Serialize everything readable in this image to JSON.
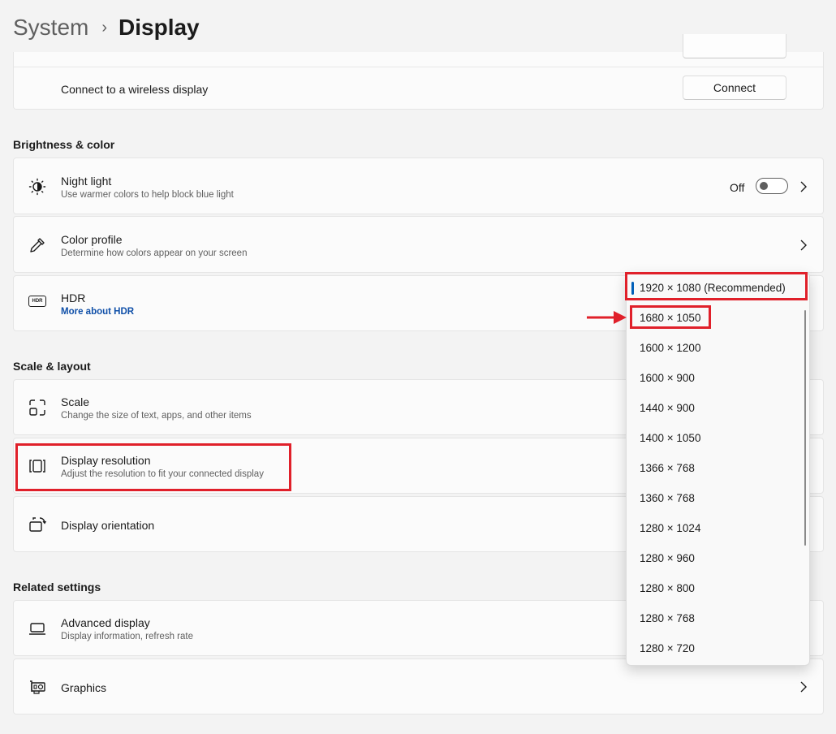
{
  "breadcrumb": {
    "parent": "System",
    "current": "Display"
  },
  "wireless": {
    "title": "Connect to a wireless display",
    "button": "Connect"
  },
  "sections": {
    "brightness": "Brightness & color",
    "scale_layout": "Scale & layout",
    "related": "Related settings"
  },
  "rows": {
    "night_light": {
      "title": "Night light",
      "subtitle": "Use warmer colors to help block blue light",
      "state": "Off"
    },
    "color_profile": {
      "title": "Color profile",
      "subtitle": "Determine how colors appear on your screen"
    },
    "hdr": {
      "title": "HDR",
      "link": "More about HDR",
      "icon_text": "HDR"
    },
    "scale": {
      "title": "Scale",
      "subtitle": "Change the size of text, apps, and other items"
    },
    "resolution": {
      "title": "Display resolution",
      "subtitle": "Adjust the resolution to fit your connected display"
    },
    "orientation": {
      "title": "Display orientation"
    },
    "advanced": {
      "title": "Advanced display",
      "subtitle": "Display information, refresh rate"
    },
    "graphics": {
      "title": "Graphics"
    }
  },
  "resolution_options": [
    "1920 × 1080 (Recommended)",
    "1680 × 1050",
    "1600 × 1200",
    "1600 × 900",
    "1440 × 900",
    "1400 × 1050",
    "1366 × 768",
    "1360 × 768",
    "1280 × 1024",
    "1280 × 960",
    "1280 × 800",
    "1280 × 768",
    "1280 × 720"
  ],
  "selected_option": "1920 × 1080 (Recommended)",
  "colors": {
    "accent": "#005fb8",
    "annotation_red": "#e0202a",
    "link": "#0f4fa8"
  }
}
